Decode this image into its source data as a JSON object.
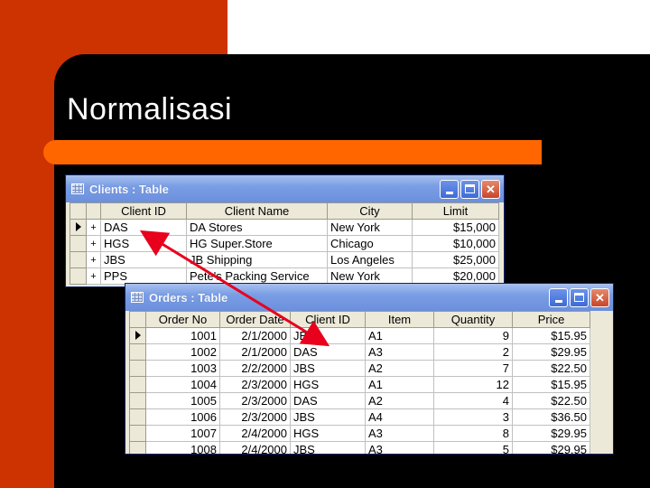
{
  "slide": {
    "title": "Normalisasi",
    "colors": {
      "red": "#cc3300",
      "orange": "#ff6600",
      "black": "#000000"
    }
  },
  "clients_window": {
    "title": "Clients : Table",
    "columns": [
      "Client ID",
      "Client Name",
      "City",
      "Limit"
    ],
    "rows": [
      {
        "id": "DAS",
        "name": "DA Stores",
        "city": "New York",
        "limit": "$15,000"
      },
      {
        "id": "HGS",
        "name": "HG Super.Store",
        "city": "Chicago",
        "limit": "$10,000"
      },
      {
        "id": "JBS",
        "name": "JB Shipping",
        "city": "Los Angeles",
        "limit": "$25,000"
      },
      {
        "id": "PPS",
        "name": "Pete's Packing Service",
        "city": "New York",
        "limit": "$20,000"
      }
    ],
    "expand_glyph": "+"
  },
  "orders_window": {
    "title": "Orders : Table",
    "columns": [
      "Order No",
      "Order Date",
      "Client ID",
      "Item",
      "Quantity",
      "Price"
    ],
    "rows": [
      {
        "order_no": "1001",
        "date": "2/1/2000",
        "client": "JBS",
        "item": "A1",
        "qty": "9",
        "price": "$15.95"
      },
      {
        "order_no": "1002",
        "date": "2/1/2000",
        "client": "DAS",
        "item": "A3",
        "qty": "2",
        "price": "$29.95"
      },
      {
        "order_no": "1003",
        "date": "2/2/2000",
        "client": "JBS",
        "item": "A2",
        "qty": "7",
        "price": "$22.50"
      },
      {
        "order_no": "1004",
        "date": "2/3/2000",
        "client": "HGS",
        "item": "A1",
        "qty": "12",
        "price": "$15.95"
      },
      {
        "order_no": "1005",
        "date": "2/3/2000",
        "client": "DAS",
        "item": "A2",
        "qty": "4",
        "price": "$22.50"
      },
      {
        "order_no": "1006",
        "date": "2/3/2000",
        "client": "JBS",
        "item": "A4",
        "qty": "3",
        "price": "$36.50"
      },
      {
        "order_no": "1007",
        "date": "2/4/2000",
        "client": "HGS",
        "item": "A3",
        "qty": "8",
        "price": "$29.95"
      },
      {
        "order_no": "1008",
        "date": "2/4/2000",
        "client": "JBS",
        "item": "A3",
        "qty": "5",
        "price": "$29.95"
      }
    ]
  },
  "arrow": {
    "color": "#e8001c"
  }
}
